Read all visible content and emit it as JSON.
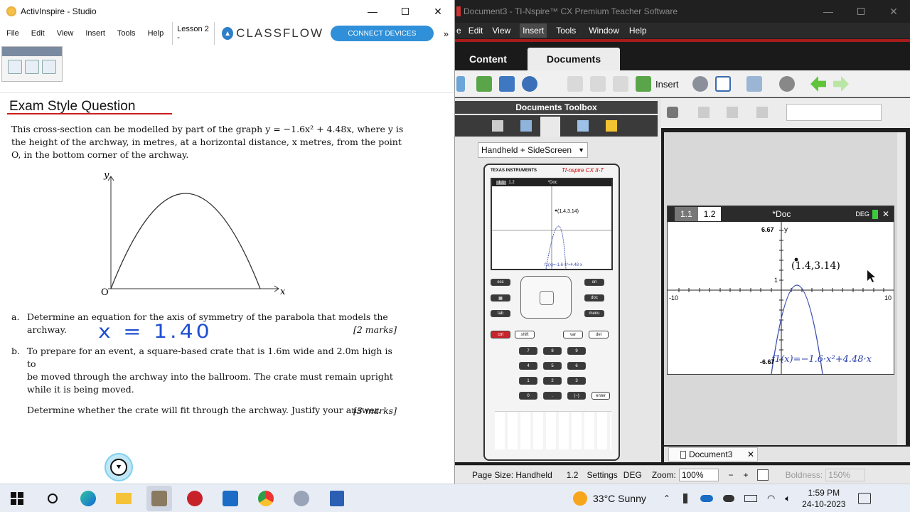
{
  "activinspire": {
    "title": "ActivInspire - Studio",
    "menu": [
      "File",
      "Edit",
      "View",
      "Insert",
      "Tools",
      "Help"
    ],
    "tab": "Lesson 2 - ",
    "brand": "CLASSFLOW",
    "connect_button": "CONNECT DEVICES",
    "more": "»"
  },
  "question": {
    "heading": "Exam Style Question",
    "intro_1": "This cross-section can be modelled by part of the graph y = −1.6x² + 4.48x, where y is",
    "intro_2": "the height of the archway, in metres, at a horizontal distance, x metres, from the point",
    "intro_3": "O, in the bottom corner of the archway.",
    "graph": {
      "y_axis": "y",
      "x_axis": "x",
      "origin": "O"
    },
    "part_a_label": "a.",
    "part_a_1": "Determine an equation for the axis of symmetry of the parabola that models the",
    "part_a_2": "archway.",
    "part_a_marks": "[2 marks]",
    "handwritten_answer": "x = 1.40",
    "part_b_label": "b.",
    "part_b_1": "To prepare for an event, a square-based crate that is 1.6m wide and 2.0m high is to",
    "part_b_2": "be moved through the archway into the ballroom. The crate must remain upright",
    "part_b_3": "while it is being moved.",
    "part_b_4": "Determine whether the crate will fit through the archway. Justify your answer.",
    "part_b_marks": "[3 marks]"
  },
  "nspire": {
    "title": "Document3 - TI-Nspire™ CX Premium Teacher Software",
    "menu": [
      "e",
      "Edit",
      "View",
      "Insert",
      "Tools",
      "Window",
      "Help"
    ],
    "tabs": {
      "content": "Content",
      "documents": "Documents"
    },
    "insert_label": "Insert",
    "toolbox_title": "Documents Toolbox",
    "view_select": "Handheld + SideScreen",
    "handheld": {
      "brand": "TEXAS INSTRUMENTS",
      "model": "TI-nspire CX II-T",
      "tab1": "1.1",
      "tab2": "1.2",
      "doc": "*Doc",
      "point": "(1.4,3.14)",
      "func": "f1(x)=-1.6·x²+4.48·x"
    },
    "graph": {
      "tab1": "1.1",
      "tab2": "1.2",
      "doc": "*Doc",
      "mode": "DEG",
      "ymax": "6.67",
      "ylabel": "y",
      "ymin": "-6.67",
      "xmin": "-10",
      "xmax": "10",
      "tick": "1",
      "point": "(1.4,3.14)",
      "func": "f1(x)=−1.6·x²+4.48·x"
    },
    "doc_tab": "Document3",
    "status": {
      "page_size": "Page Size: Handheld",
      "page": "1.2",
      "settings": "Settings",
      "angle": "DEG",
      "zoom_label": "Zoom:",
      "zoom": "100%",
      "boldness_label": "Boldness:",
      "boldness": "150%"
    }
  },
  "taskbar": {
    "weather": "33°C  Sunny",
    "time": "1:59 PM",
    "date": "24-10-2023"
  },
  "colors": {
    "red": "#cc1f1f",
    "blue_button": "#2f8fd8",
    "nspire_dark": "#1e1e1e",
    "handwriting": "#1d4fd1"
  }
}
